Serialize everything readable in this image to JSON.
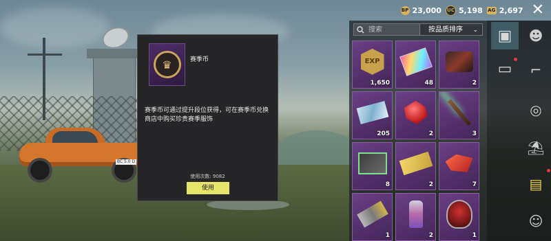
{
  "currency": {
    "bp": {
      "icon": "bp-coin-icon",
      "label": "BP",
      "value": "23,000"
    },
    "uc": {
      "icon": "uc-coin-icon",
      "label": "UC",
      "value": "5,198"
    },
    "ag": {
      "icon": "ag-ticket-icon",
      "label": "AG",
      "value": "2,697"
    }
  },
  "dialog": {
    "item_name": "赛季币",
    "description": "赛季币可通过提升段位获得，可在赛季币兑换商店中购买珍贵赛季服饰",
    "usage_count_text": "使用次数: 9082",
    "use_button_label": "使用"
  },
  "inventory": {
    "search_placeholder": "搜索",
    "sort_label": "按品质排序",
    "items": [
      {
        "name": "exp-card",
        "icon": "exp-badge-icon",
        "qty": "1,650",
        "icon_text": "EXP"
      },
      {
        "name": "rainbow-card",
        "icon": "rainbow-card-icon",
        "qty": "48"
      },
      {
        "name": "vehicle-engine",
        "icon": "engine-icon",
        "qty": "2"
      },
      {
        "name": "ticket",
        "icon": "ticket-icon",
        "qty": "205"
      },
      {
        "name": "red-gem",
        "icon": "red-gem-icon",
        "qty": "2"
      },
      {
        "name": "magic-wand",
        "icon": "wand-icon",
        "qty": "3"
      },
      {
        "name": "supply-crate",
        "icon": "crate-icon",
        "qty": "8"
      },
      {
        "name": "voucher",
        "icon": "voucher-icon",
        "qty": "2"
      },
      {
        "name": "red-crystal",
        "icon": "crystal-icon",
        "qty": "7"
      },
      {
        "name": "weapon-skin",
        "icon": "weapon-skin-icon",
        "qty": "1"
      },
      {
        "name": "spray-can",
        "icon": "spray-icon",
        "qty": "2"
      },
      {
        "name": "helmet",
        "icon": "helmet-icon",
        "qty": "1"
      }
    ]
  },
  "sidebar": {
    "categories": [
      "consumables-icon",
      "character-icon",
      "weapon-icon",
      "vehicle-icon",
      "parachute-icon",
      "crate-icon",
      "emote-icon"
    ]
  },
  "car": {
    "plate": "BC 5.0 D"
  }
}
